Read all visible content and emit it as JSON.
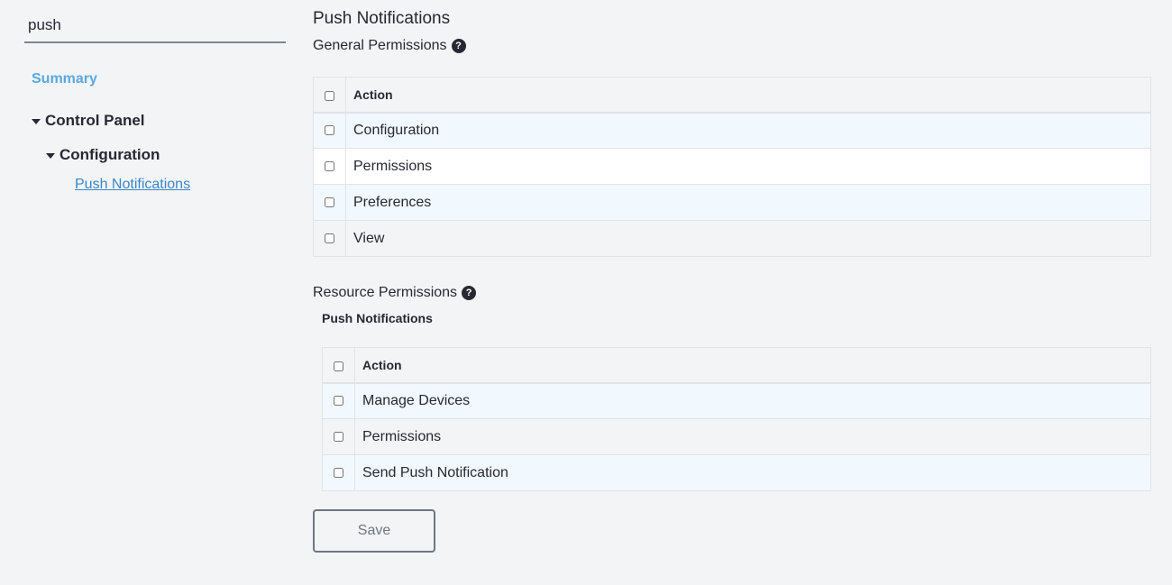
{
  "sidebar": {
    "search_value": "push",
    "summary_label": "Summary",
    "tree": {
      "control_panel": "Control Panel",
      "configuration": "Configuration",
      "push_notifications": "Push Notifications"
    }
  },
  "main": {
    "title": "Push Notifications",
    "general": {
      "title": "General Permissions",
      "help": "?",
      "header": "Action",
      "rows": [
        "Configuration",
        "Permissions",
        "Preferences",
        "View"
      ]
    },
    "resource": {
      "title": "Resource Permissions",
      "help": "?",
      "subtitle": "Push Notifications",
      "header": "Action",
      "rows": [
        "Manage Devices",
        "Permissions",
        "Send Push Notification"
      ]
    },
    "save_label": "Save"
  }
}
